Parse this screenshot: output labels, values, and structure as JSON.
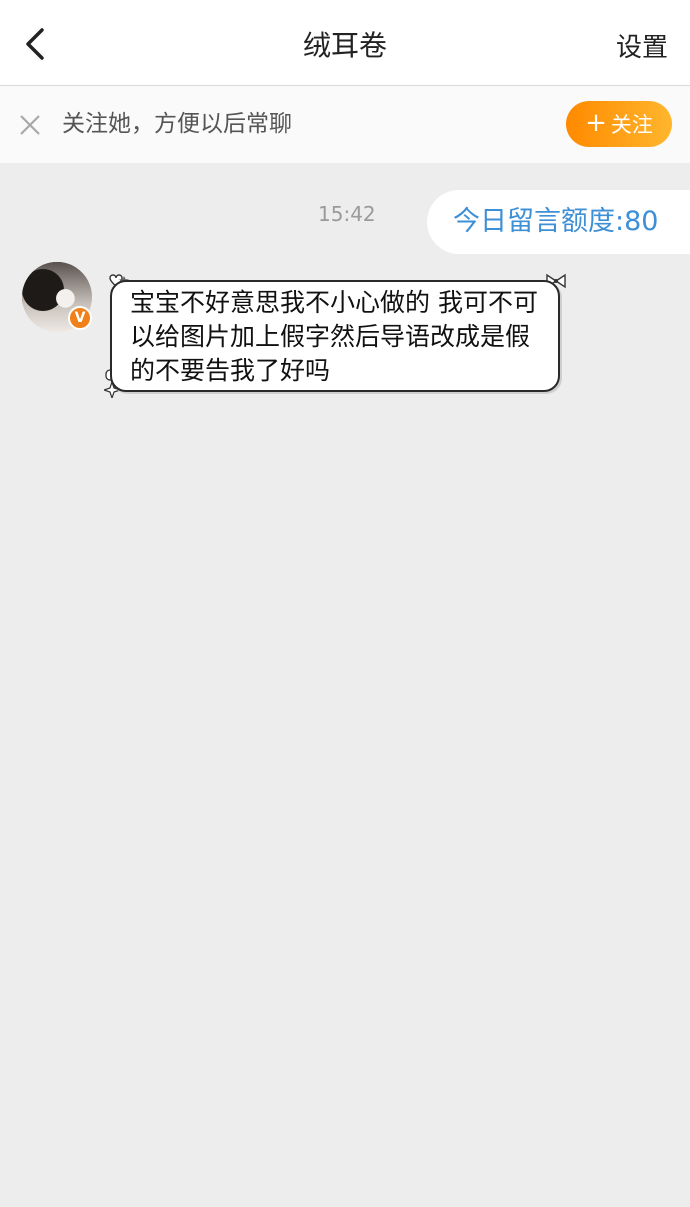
{
  "header": {
    "title": "绒耳卷",
    "settings_label": "设置"
  },
  "follow_bar": {
    "text": "关注她，方便以后常聊",
    "button_label": "关注",
    "button_colors": [
      "#ff8a00",
      "#ffb62e"
    ]
  },
  "chat": {
    "timestamp": "15:42",
    "quota_text": "今日留言额度:80",
    "messages": [
      {
        "sender": "other",
        "verified_badge": "V",
        "text": "宝宝不好意思我不小心做的 我可不可以给图片加上假字然后导语改成是假的不要告我了好吗"
      }
    ]
  },
  "colors": {
    "background": "#ededed",
    "quota_text": "#3d8fd6",
    "badge": "#f08019"
  },
  "icons": {
    "back": "chevron-left-icon",
    "close": "close-icon",
    "plus": "plus-icon"
  }
}
